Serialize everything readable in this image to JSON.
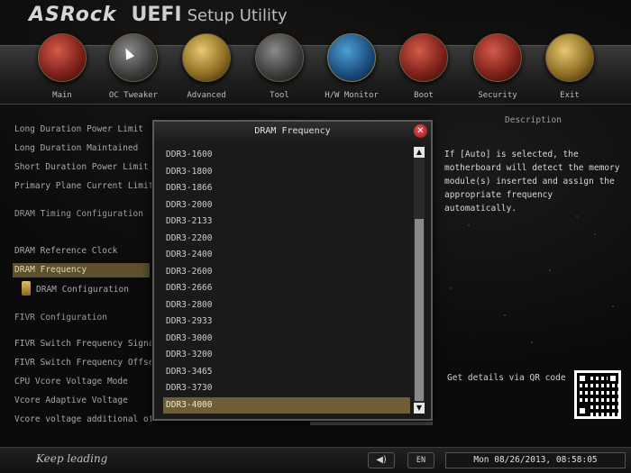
{
  "brand": {
    "logo": "ASRock",
    "title": "UEFI",
    "subtitle": "Setup Utility"
  },
  "nav": {
    "items": [
      {
        "label": "Main",
        "icon": "main-icon"
      },
      {
        "label": "OC Tweaker",
        "icon": "oc-tweaker-icon"
      },
      {
        "label": "Advanced",
        "icon": "advanced-icon"
      },
      {
        "label": "Tool",
        "icon": "tool-icon"
      },
      {
        "label": "H/W Monitor",
        "icon": "hw-monitor-icon"
      },
      {
        "label": "Boot",
        "icon": "boot-icon"
      },
      {
        "label": "Security",
        "icon": "security-icon"
      },
      {
        "label": "Exit",
        "icon": "exit-icon"
      }
    ]
  },
  "settings": {
    "items": [
      {
        "label": "Long Duration Power Limit",
        "type": "item"
      },
      {
        "label": "Long Duration Maintained",
        "type": "item"
      },
      {
        "label": "Short Duration Power Limit",
        "type": "item"
      },
      {
        "label": "Primary Plane Current Limit",
        "type": "item"
      },
      {
        "label": "DRAM Timing Configuration",
        "type": "section"
      },
      {
        "label": "DRAM Reference Clock",
        "type": "item"
      },
      {
        "label": "DRAM Frequency",
        "type": "selected"
      },
      {
        "label": "DRAM Configuration",
        "type": "sub"
      },
      {
        "label": "FIVR Configuration",
        "type": "section"
      },
      {
        "label": "FIVR Switch Frequency Signature",
        "type": "item"
      },
      {
        "label": "FIVR Switch Frequency Offset",
        "type": "item"
      },
      {
        "label": "CPU Vcore Voltage Mode",
        "type": "item"
      },
      {
        "label": "Vcore Adaptive Voltage",
        "type": "item"
      },
      {
        "label": "Vcore voltage additional offset",
        "type": "item"
      }
    ]
  },
  "description": {
    "title": "Description",
    "text": "If [Auto] is selected, the motherboard will detect the memory module(s) inserted and assign the appropriate frequency automatically.",
    "qr_label": "Get details via QR code"
  },
  "modal": {
    "title": "DRAM Frequency",
    "close_label": "✕",
    "options": [
      "DDR3-1600",
      "DDR3-1800",
      "DDR3-1866",
      "DDR3-2000",
      "DDR3-2133",
      "DDR3-2200",
      "DDR3-2400",
      "DDR3-2600",
      "DDR3-2666",
      "DDR3-2800",
      "DDR3-2933",
      "DDR3-3000",
      "DDR3-3200",
      "DDR3-3465",
      "DDR3-3730",
      "DDR3-4000"
    ],
    "selected_index": 15,
    "scroll_up": "▲",
    "scroll_down": "▼"
  },
  "footer": {
    "slogan": "Keep leading",
    "sound_icon": "◀)",
    "language": "EN",
    "datetime": "Mon 08/26/2013, 08:58:05"
  },
  "colors": {
    "highlight": "#6e5e38",
    "close_button": "#d02020"
  }
}
